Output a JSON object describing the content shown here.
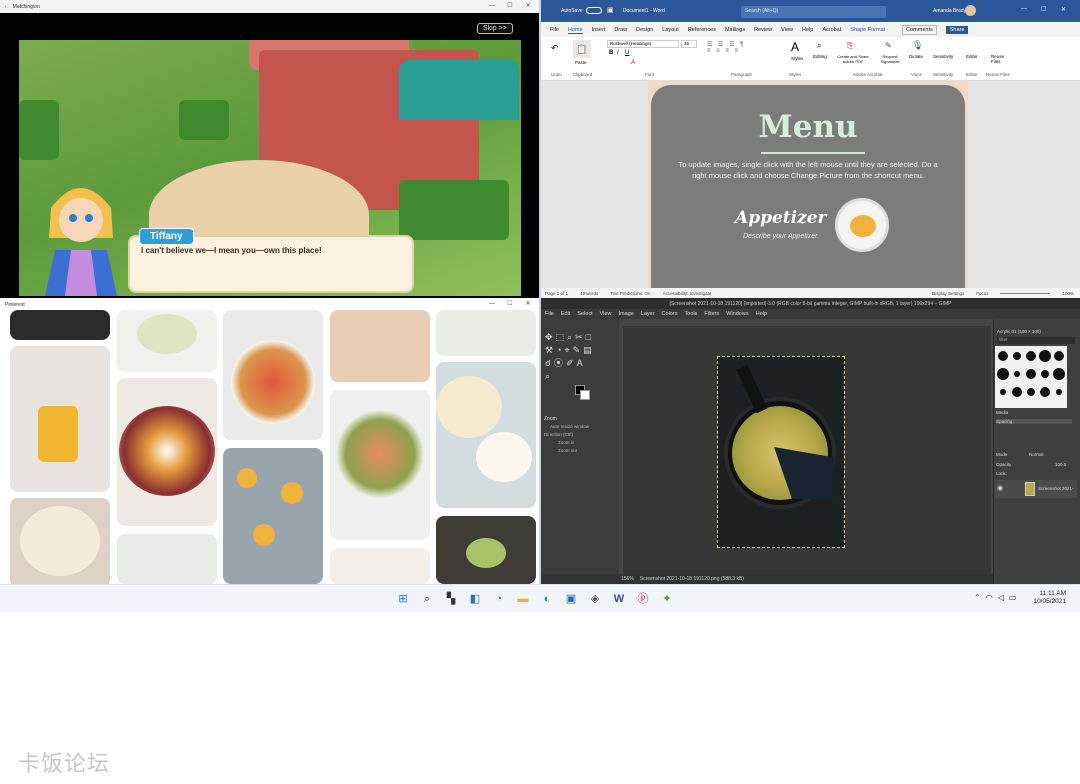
{
  "game": {
    "title": "Matchington",
    "skip_label": "Skip >>",
    "character_name": "Tiffany",
    "dialog_text": "I can't believe we—I mean you—own this place!"
  },
  "word": {
    "autosave": "AutoSave",
    "doc_title": "Document1 - Word",
    "search_placeholder": "Search (Alt+Q)",
    "user": "Amanda Brady",
    "tabs": [
      "File",
      "Home",
      "Insert",
      "Draw",
      "Design",
      "Layout",
      "References",
      "Mailings",
      "Review",
      "View",
      "Help",
      "Acrobat",
      "Shape Format"
    ],
    "comments_label": "Comments",
    "share_label": "Share",
    "font_name": "Rockwell (Headings)",
    "font_size": "36",
    "ribbon_groups": [
      "Undo",
      "Clipboard",
      "Font",
      "Paragraph",
      "Styles",
      "Adobe Acrobat",
      "Voice",
      "Sensitivity",
      "Editor",
      "Reuse Files"
    ],
    "ribbon_buttons": [
      "Paste",
      "Styles",
      "Editing",
      "Create and Share Adobe PDF",
      "Request Signatures",
      "Dictate",
      "Sensitivity",
      "Editor",
      "Reuse Files"
    ],
    "menu_title": "Menu",
    "menu_desc": "To update images, single click with the left mouse until they are selected. Do a right mouse click and choose Change Picture from the shortcut menu.",
    "appetizer": "Appetizer",
    "appetizer_desc": "Describe your Appetizer.",
    "status": [
      "Page 1 of 1",
      "49 words",
      "Text Predictions: On",
      "Accessibility: Investigate"
    ],
    "status_right": [
      "Display Settings",
      "Focus",
      "100%"
    ]
  },
  "pinterest": {
    "title": "Pinterest"
  },
  "gimp": {
    "title": "[Screenshot 2021-10-18 191120] (imported)-3.0 (RGB color 8-bit gamma integer, GIMP built-in sRGB, 1 layer) 190x294 – GIMP",
    "menus": [
      "File",
      "Edit",
      "Select",
      "View",
      "Image",
      "Layer",
      "Colors",
      "Tools",
      "Filters",
      "Windows",
      "Help"
    ],
    "zoom_heading": "Zoom",
    "auto_resize": "Auto-resize window",
    "direction": "Direction (Ctrl)",
    "zoom_in": "Zoom in",
    "zoom_out": "Zoom out",
    "brush_label": "Acrylic 01 (100 × 100)",
    "filter_label": "filter",
    "media_label": "Media",
    "spacing_label": "Spacing",
    "mode_label": "Mode",
    "mode_value": "Normal",
    "opacity_label": "Opacity",
    "opacity_value": "100.0",
    "lock_label": "Lock:",
    "layer_name": "Screenshot 2021-",
    "zoom_level": "156%",
    "status_file": "Screenshot 2021-10-18 191120.png (588.3 kB)"
  },
  "taskbar": {
    "time": "11:11 AM",
    "date": "10/05/2021"
  },
  "watermark": "卡饭论坛",
  "colors": {
    "word_blue": "#2b579a",
    "gimp_dark": "#454545",
    "taskbar": "#f1f4f9"
  }
}
